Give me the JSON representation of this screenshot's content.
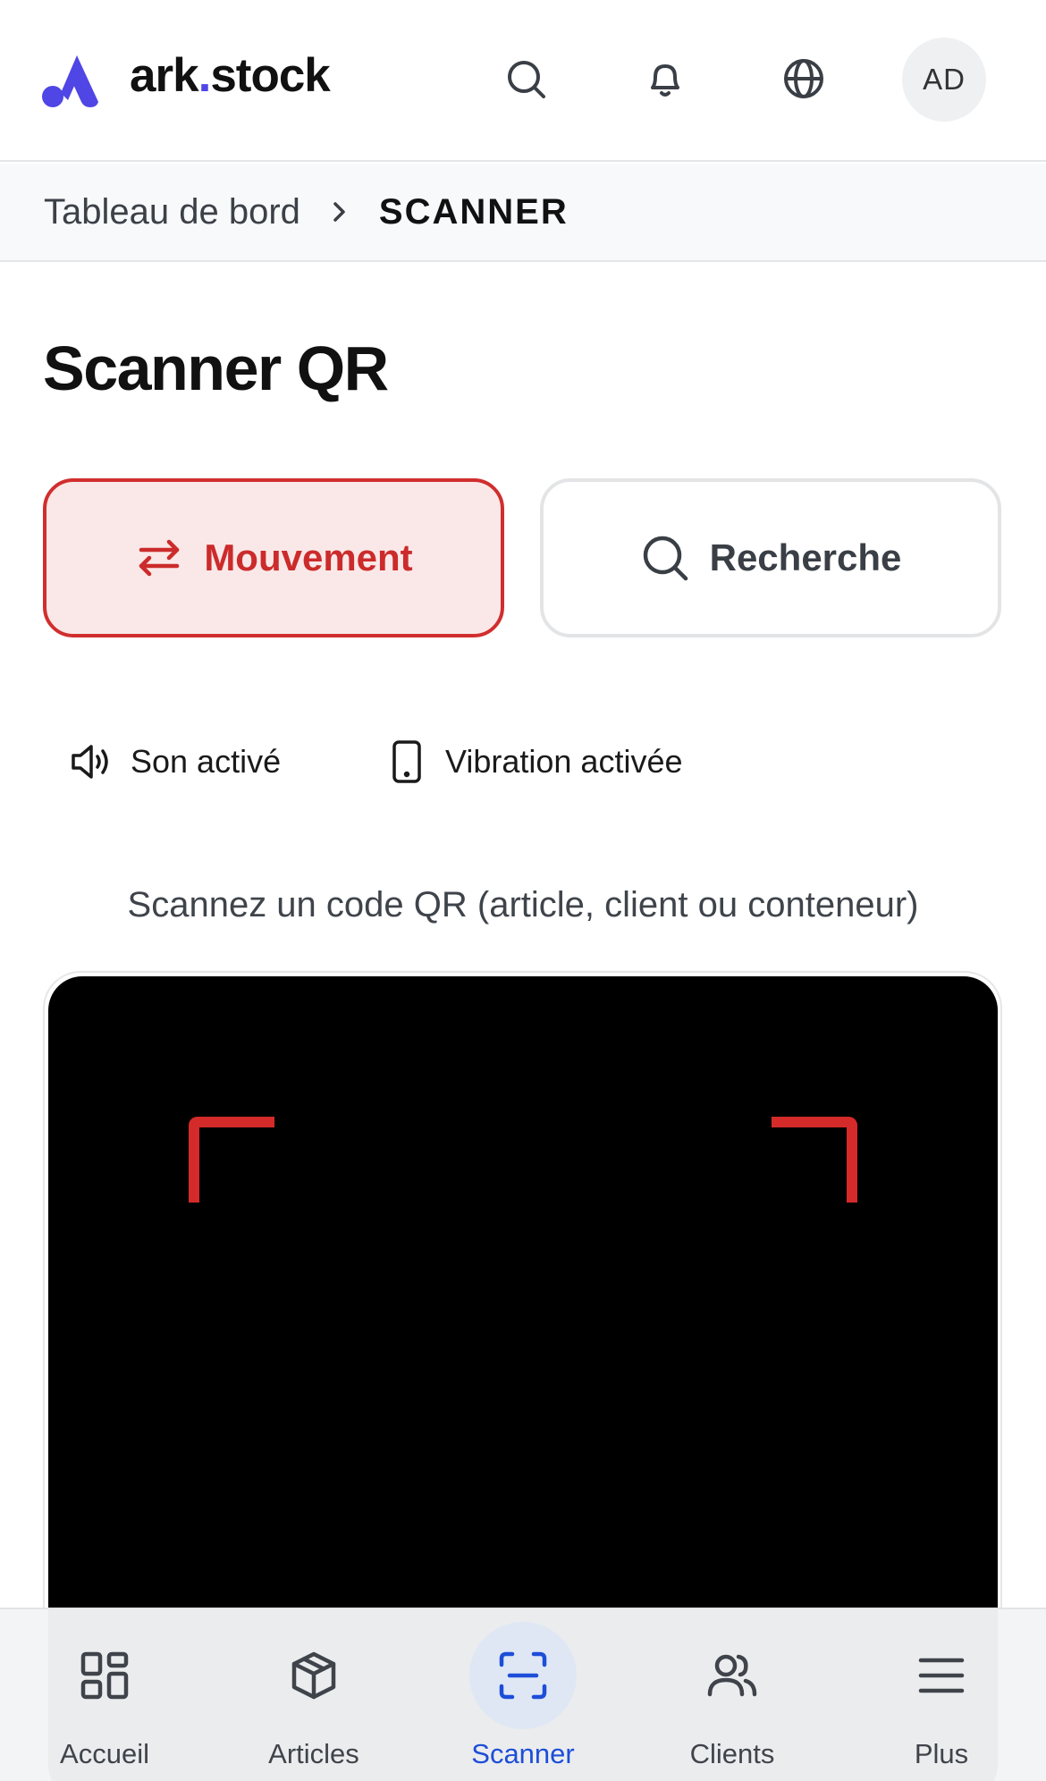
{
  "header": {
    "brand_prefix": "ark",
    "brand_dot": ".",
    "brand_suffix": "stock",
    "avatar_initials": "AD",
    "icons": [
      "search-icon",
      "bell-icon",
      "globe-icon"
    ]
  },
  "breadcrumb": {
    "parent": "Tableau de bord",
    "current": "SCANNER"
  },
  "page": {
    "title": "Scanner QR"
  },
  "modes": {
    "movement_label": "Mouvement",
    "search_label": "Recherche",
    "active": "movement"
  },
  "toggles": {
    "sound_label": "Son activé",
    "vibration_label": "Vibration activée"
  },
  "scanner": {
    "instruction": "Scannez un code QR (article, client ou conteneur)"
  },
  "bottom_nav": {
    "items": [
      {
        "label": "Accueil",
        "icon": "grid-icon"
      },
      {
        "label": "Articles",
        "icon": "box-icon"
      },
      {
        "label": "Scanner",
        "icon": "scan-icon"
      },
      {
        "label": "Clients",
        "icon": "users-icon"
      },
      {
        "label": "Plus",
        "icon": "menu-icon"
      }
    ],
    "active_index": 2
  },
  "colors": {
    "brand_accent": "#4f46e5",
    "active_mode": "#cc2b2b",
    "active_mode_bg": "#fae8e8",
    "nav_active": "#1d4ed8",
    "scan_corner": "#d42a2a"
  }
}
